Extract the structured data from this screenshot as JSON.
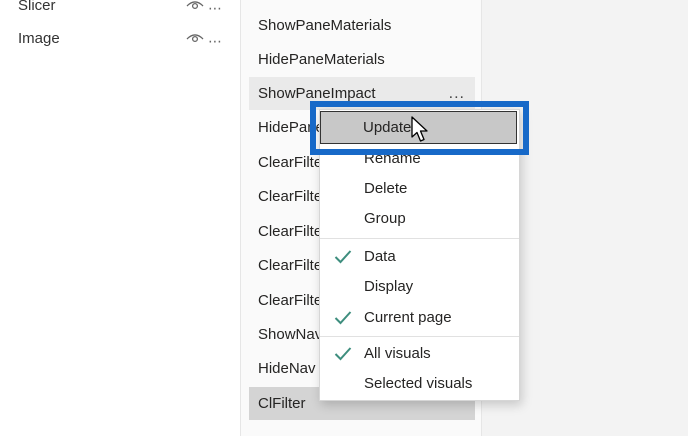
{
  "selection_pane": {
    "items": [
      {
        "label": "Slicer"
      },
      {
        "label": "Image"
      }
    ]
  },
  "bookmarks": {
    "items": [
      {
        "label": "ShowPaneMaterials"
      },
      {
        "label": "HidePaneMaterials"
      },
      {
        "label": "ShowPaneImpact",
        "more": "..."
      },
      {
        "label": "HidePaneImpact"
      },
      {
        "label": "ClearFilter"
      },
      {
        "label": "ClearFilter"
      },
      {
        "label": "ClearFilter"
      },
      {
        "label": "ClearFilter"
      },
      {
        "label": "ClearFilter"
      },
      {
        "label": "ShowNav"
      },
      {
        "label": "HideNav"
      },
      {
        "label": "ClFilter"
      }
    ]
  },
  "context_menu": {
    "update": "Update",
    "rename": "Rename",
    "delete": "Delete",
    "group": "Group",
    "data": "Data",
    "display": "Display",
    "current_page": "Current page",
    "all_visuals": "All visuals",
    "selected_visuals": "Selected visuals"
  },
  "colors": {
    "check": "#3e8e7e",
    "highlight": "#1769c8"
  }
}
